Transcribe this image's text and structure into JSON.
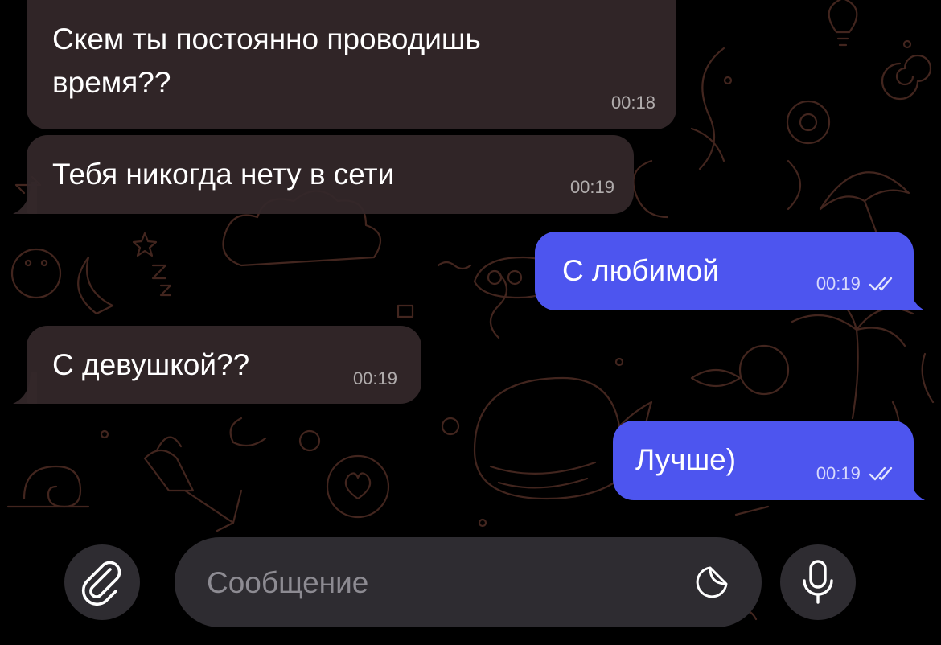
{
  "messages": [
    {
      "direction": "incoming",
      "text": "Скем ты постоянно проводишь\nвремя??",
      "time": "00:18"
    },
    {
      "direction": "incoming",
      "text": "Тебя никогда нету в сети",
      "time": "00:19"
    },
    {
      "direction": "outgoing",
      "text": "С любимой",
      "time": "00:19",
      "status": "read"
    },
    {
      "direction": "incoming",
      "text": "С девушкой??",
      "time": "00:19"
    },
    {
      "direction": "outgoing",
      "text": "Лучше)",
      "time": "00:19",
      "status": "read"
    }
  ],
  "composer": {
    "placeholder": "Сообщение"
  },
  "icons": {
    "attach": "paperclip-icon",
    "sticker": "sticker-icon",
    "voice": "microphone-icon",
    "read_status": "double-check-icon"
  },
  "colors": {
    "background": "#000000",
    "incoming_bubble": "#34282a",
    "outgoing_bubble": "#4d55ef",
    "composer": "#2e2c31",
    "wallpaper_doodles": "#4a2a22"
  }
}
